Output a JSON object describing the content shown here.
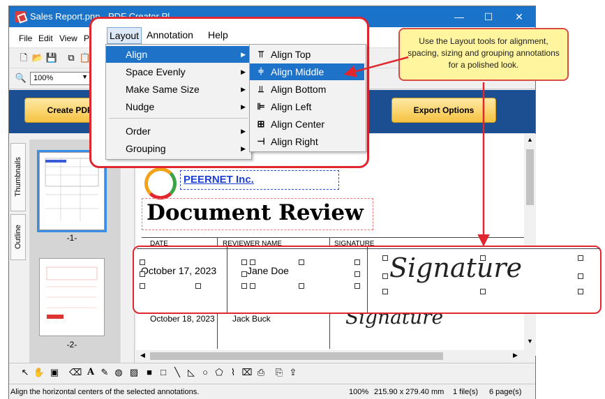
{
  "window": {
    "title": "Sales Report.pnp - PDF Creator Plus",
    "title_visible": "Sales Report.pnp - PDF Creator Pl",
    "minimize": "—",
    "maximize": "☐",
    "close": "✕"
  },
  "menubar": {
    "items": [
      "File",
      "Edit",
      "View",
      "Page",
      "Layout",
      "Annotation",
      "Help"
    ]
  },
  "toolbar": {
    "zoom": "100%"
  },
  "bluebar": {
    "create_label": "Create PDF",
    "export_label": "Export Options"
  },
  "layout_menu": {
    "items": [
      "Align",
      "Space Evenly",
      "Make Same Size",
      "Nudge",
      "Order",
      "Grouping"
    ],
    "highlighted": "Align"
  },
  "align_submenu": {
    "items": [
      "Align Top",
      "Align Middle",
      "Align Bottom",
      "Align Left",
      "Align Center",
      "Align Right"
    ],
    "highlighted": "Align Middle"
  },
  "left_panel": {
    "tab_thumbnails": "Thumbnails",
    "tab_outline": "Outline",
    "thumb1_label": "-1-",
    "thumb2_label": "-2-"
  },
  "document": {
    "company": "PEERNET Inc.",
    "heading": "Document Review",
    "col_date": "DATE",
    "col_reviewer": "REVIEWER NAME",
    "col_signature": "SIGNATURE",
    "row1_date": "October  17, 2023",
    "row1_name": "Jane Doe",
    "row1_sig": "Signature",
    "row2_date": "October 18, 2023",
    "row2_name": "Jack Buck",
    "row2_sig": "Signature"
  },
  "callout": {
    "text": "Use the Layout tools for alignment, spacing, sizing and grouping annotations for a polished look."
  },
  "statusbar": {
    "message": "Align the horizontal centers of the selected annotations.",
    "zoom": "100%",
    "size": "215.90 x 279.40 mm",
    "files": "1 file(s)",
    "pages": "6 page(s)"
  },
  "colors": {
    "accent": "#1e73c9",
    "highlight_ring": "#e0262f",
    "callout_bg": "#fff59e",
    "header_band": "#1b4f91",
    "button_gold": "#f6c342"
  }
}
